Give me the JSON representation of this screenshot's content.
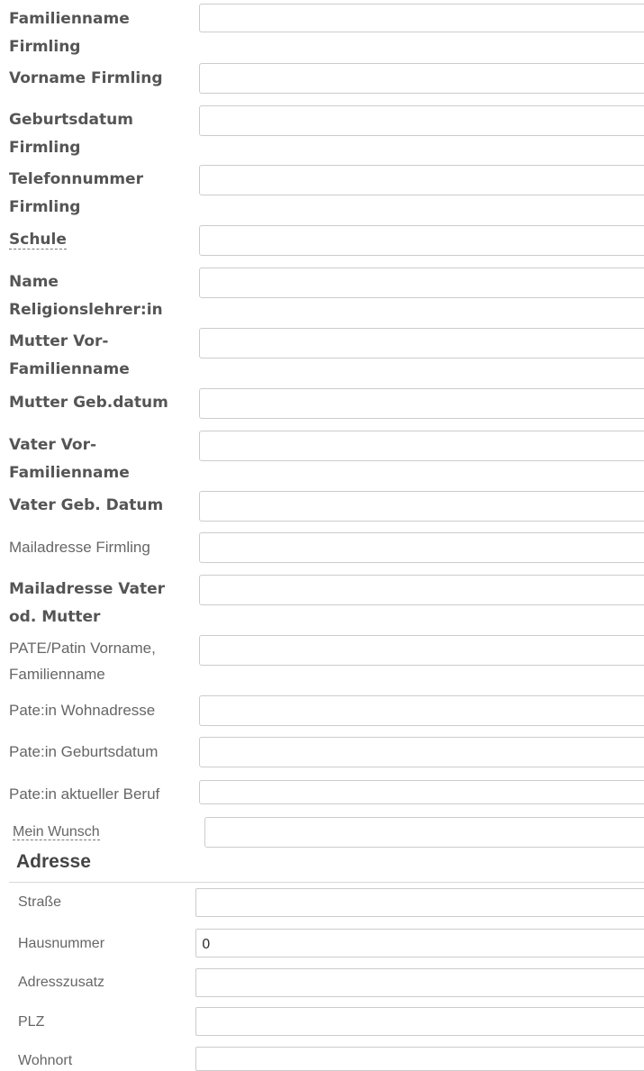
{
  "form": {
    "fields": [
      {
        "label": "Familienname Firmling",
        "value": ""
      },
      {
        "label": "Vorname Firmling",
        "value": ""
      },
      {
        "label": "Geburtsdatum Firmling",
        "value": ""
      },
      {
        "label": "Telefonnummer Firmling",
        "value": ""
      },
      {
        "label": "Schule",
        "value": ""
      },
      {
        "label": "Name Religionslehrer:in",
        "value": ""
      },
      {
        "label": "Mutter Vor-Familienname",
        "value": ""
      },
      {
        "label": "Mutter Geb.datum",
        "value": ""
      },
      {
        "label": "Vater Vor-Familienname",
        "value": ""
      },
      {
        "label": "Vater Geb. Datum",
        "value": ""
      },
      {
        "label": "Mailadresse Firmling",
        "value": ""
      },
      {
        "label": "Mailadresse Vater od. Mutter",
        "value": ""
      },
      {
        "label": "PATE/Patin Vorname, Familienname",
        "value": ""
      },
      {
        "label": "Pate:in Wohnadresse",
        "value": ""
      },
      {
        "label": "Pate:in Geburtsdatum",
        "value": ""
      },
      {
        "label": "Pate:in aktueller Beruf",
        "value": ""
      },
      {
        "label": "Mein Wunsch",
        "value": ""
      }
    ]
  },
  "address": {
    "title": "Adresse",
    "fields": [
      {
        "label": "Straße",
        "value": ""
      },
      {
        "label": "Hausnummer",
        "value": "0"
      },
      {
        "label": "Adresszusatz",
        "value": ""
      },
      {
        "label": "PLZ",
        "value": ""
      },
      {
        "label": "Wohnort",
        "value": ""
      }
    ]
  }
}
